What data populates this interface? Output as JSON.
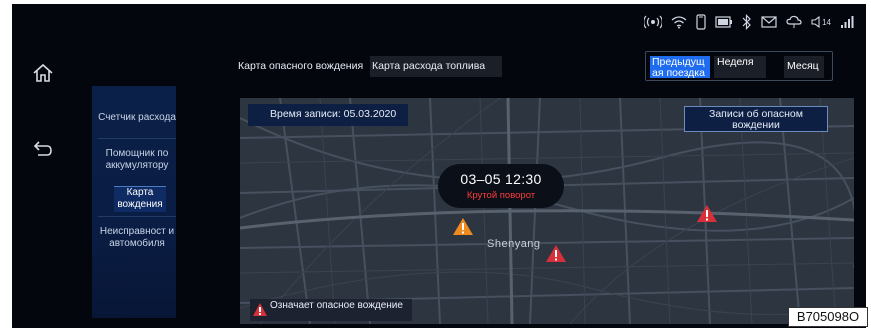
{
  "status_bar": {
    "icons": [
      "hotspot-icon",
      "wifi-icon",
      "phone-icon",
      "battery-icon",
      "bluetooth-icon",
      "mail-icon",
      "cloud-icon",
      "volume-icon",
      "signal-icon"
    ],
    "volume_value": "14"
  },
  "rail": {
    "icons": [
      "home-icon",
      "back-icon"
    ]
  },
  "menu": {
    "items": [
      {
        "label": "Счетчик расхода"
      },
      {
        "label": "Помощник по аккумулятору"
      },
      {
        "label": "Карта вождения"
      },
      {
        "label": "Неисправност и автомобиля"
      }
    ],
    "active_index": 2
  },
  "tabs": {
    "danger_map": "Карта опасного вождения",
    "fuel_map": "Карта расхода топлива"
  },
  "period": {
    "options": [
      "Предыдущ ая поездка",
      "Неделя",
      "Месяц"
    ],
    "selected": "Предыдущ ая поездка"
  },
  "map": {
    "record_time": "Время записи: 05.03.2020",
    "danger_records_button": "Записи об опасном вождении",
    "event_time": "03–05 12:30",
    "event_type": "Крутой поворот",
    "city": "Shenyang",
    "legend": "Означает опасное вождение",
    "colors": {
      "warning": "#ee8a1e",
      "danger": "#d8303a",
      "selected_tab": "#1e6cf0"
    }
  },
  "figure_code": "B705098O"
}
